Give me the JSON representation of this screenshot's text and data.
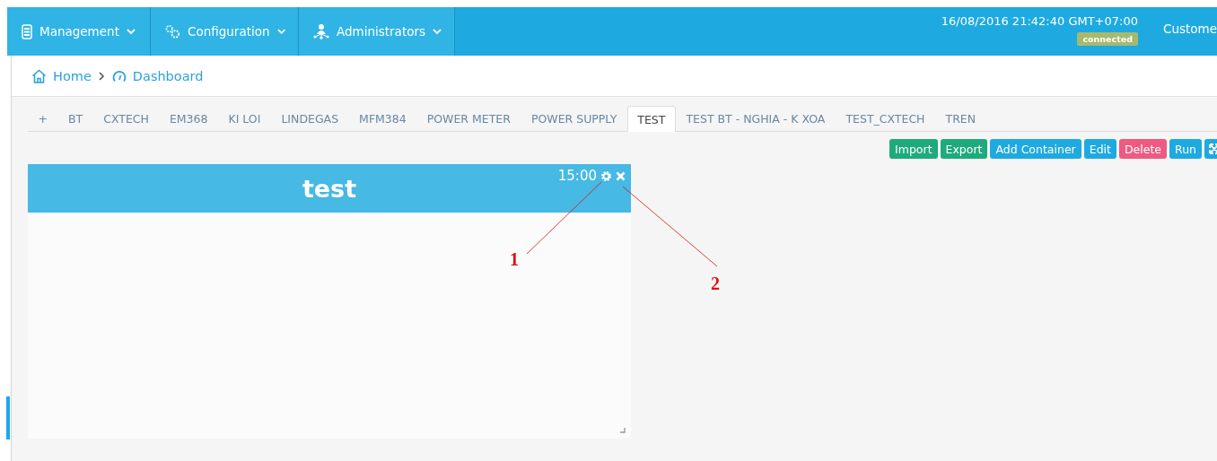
{
  "top_menu": [
    {
      "label": "Management",
      "kind": "battery"
    },
    {
      "label": "Configuration",
      "kind": "gears"
    },
    {
      "label": "Administrators",
      "kind": "network"
    }
  ],
  "datetime": "16/08/2016 21:42:40 GMT+07:00",
  "connection_badge": "connected",
  "user_menu": "Custome",
  "breadcrumb": [
    {
      "label": "Home",
      "kind": "home"
    },
    {
      "label": "Dashboard",
      "kind": "gauge"
    }
  ],
  "tabs": [
    {
      "label": "+",
      "selected": false
    },
    {
      "label": "BT",
      "selected": false
    },
    {
      "label": "CXTECH",
      "selected": false
    },
    {
      "label": "EM368",
      "selected": false
    },
    {
      "label": "KI LOI",
      "selected": false
    },
    {
      "label": "LINDEGAS",
      "selected": false
    },
    {
      "label": "MFM384",
      "selected": false
    },
    {
      "label": "POWER METER",
      "selected": false
    },
    {
      "label": "POWER SUPPLY",
      "selected": false
    },
    {
      "label": "TEST",
      "selected": true
    },
    {
      "label": "TEST BT - NGHIA - K XOA",
      "selected": false
    },
    {
      "label": "TEST_CXTECH",
      "selected": false
    },
    {
      "label": "TREN",
      "selected": false
    }
  ],
  "toolbar": [
    {
      "label": "Import",
      "kind": "success"
    },
    {
      "label": "Export",
      "kind": "success"
    },
    {
      "label": "Add Container",
      "kind": "primary"
    },
    {
      "label": "Edit",
      "kind": "primary"
    },
    {
      "label": "Delete",
      "kind": "danger"
    },
    {
      "label": "Run",
      "kind": "primary"
    },
    {
      "kind": "fullscreen"
    }
  ],
  "widget": {
    "title": "test",
    "time": "15:00"
  },
  "annotations": [
    "1",
    "2"
  ]
}
